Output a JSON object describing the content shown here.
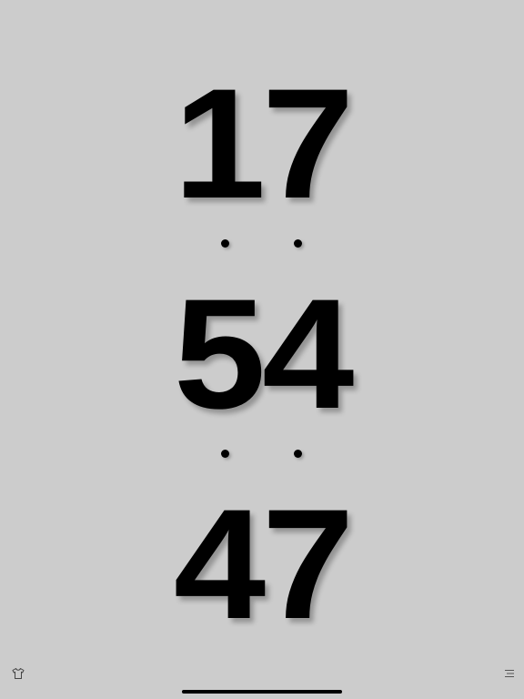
{
  "clock": {
    "hours": "17",
    "minutes": "54",
    "seconds": "47"
  },
  "toolbar": {
    "left_icon": "shirt-icon",
    "right_icon": "menu-icon"
  },
  "colors": {
    "background": "#cccccc",
    "digits": "#000000"
  }
}
